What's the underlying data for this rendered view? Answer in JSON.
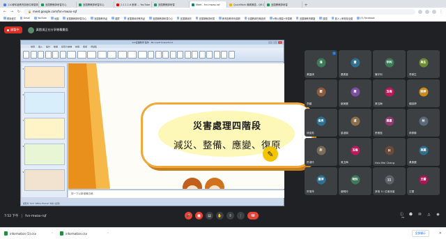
{
  "browser": {
    "tabs": [
      {
        "label": "110學年度教育部數位學習精",
        "color": "#4285f4"
      },
      {
        "label": "宜蘭縣教師研習中心",
        "color": "#0f9d58"
      },
      {
        "label": "宜蘭縣教師研習中心",
        "color": "#0f9d58"
      },
      {
        "label": "2.2.1.1.6 數學 ... YouTube",
        "color": "#ff0000"
      },
      {
        "label": "宜蘭縣教師研習",
        "color": "#0f9d58"
      },
      {
        "label": "Meet - fvn-mwao-rqf",
        "color": "#00897b",
        "active": true
      },
      {
        "label": "QuickMark 條碼掃描 - QR Co",
        "color": "#f4b400"
      },
      {
        "label": "宜蘭縣教師研習",
        "color": "#0f9d58"
      }
    ],
    "url": "meet.google.com/fvn-mwao-rqf",
    "bookmarks": [
      "應用程式",
      "Gmail",
      "YouTube",
      "地圖",
      "宜蘭縣教師研習中心",
      "宜蘭縣教育處",
      "翻譯",
      "宜蘭縣政府教育處",
      "宜蘭縣教師研習中心",
      "宜蘭縣政府",
      "宜蘭縣教師研習",
      "教育部教學資源網",
      "全國教師在職進修",
      "e等公務園+學習網",
      "宜蘭縣教育網路",
      "國語",
      "登入 | 教育部全國",
      "(3) Facebook"
    ]
  },
  "meet": {
    "recording_label": "錄製中",
    "presenter_label": "黃園鴻正在分享螢幕畫面",
    "time": "7:52 下午",
    "code": "fvn-mwao-rqf",
    "participant_count": "23"
  },
  "ppt": {
    "window_title": "110宜蘭教學 製作 - Microsoft PowerPoint",
    "menus": [
      "常用",
      "插入",
      "設計",
      "動畫",
      "投影片放映",
      "校閱",
      "檢視",
      "增益集"
    ],
    "slide_numbers": [
      "5",
      "6",
      "7",
      "8",
      "9"
    ],
    "notes_placeholder": "按一下以新增備忘稿",
    "status": "投影片 7/13   \"Office Theme\"   中文 (台灣)",
    "slide": {
      "title": "災害處理四階段",
      "subtitle": "減災、整備、應變、復原"
    }
  },
  "participants": [
    {
      "name": "黃園鴻",
      "initial": "鴻",
      "color": "#3d7a59",
      "mic": true
    },
    {
      "name": "蕭慶豪",
      "initial": "蕭",
      "color": "#2f6f8f"
    },
    {
      "name": "陳宇利",
      "initial": "宇利",
      "color": "#3d7a59"
    },
    {
      "name": "李美生",
      "initial": "美生",
      "color": "#6c8a2f"
    },
    {
      "name": "李穎",
      "initial": "穎",
      "color": "#8c5a3c"
    },
    {
      "name": "鄭美麗",
      "initial": "鄭",
      "color": "#7a4fa0"
    },
    {
      "name": "張玉梅",
      "initial": "玉梅",
      "color": "#c2185b"
    },
    {
      "name": "鍾詩婷",
      "initial": "詩婷",
      "color": "#c98a1a"
    },
    {
      "name": "林俊男",
      "initial": "俊男",
      "color": "#2f6f8f"
    },
    {
      "name": "梁淑娟",
      "initial": "淑",
      "color": "#8d6e4a"
    },
    {
      "name": "許雅惠",
      "initial": "雅惠",
      "color": "#8e3a6f"
    },
    {
      "name": "林佩琳",
      "initial": "林",
      "color": "#5a6a7a"
    },
    {
      "name": "許淑玲",
      "initial": "許",
      "color": "#7a6a5a"
    },
    {
      "name": "吳玉梅",
      "initial": "玉梅",
      "color": "#c2185b"
    },
    {
      "name": "Hsiu Mei Chang",
      "initial": "H",
      "color": "#6a4a3a"
    },
    {
      "name": "黃美麗",
      "initial": "美麗",
      "color": "#2f6f8f"
    },
    {
      "name": "許惠萍",
      "initial": "惠萍",
      "color": "#2f6f8f"
    },
    {
      "name": "趙明玲",
      "initial": "明玲",
      "color": "#3d7a59"
    },
    {
      "name": "其他 11 位使用者",
      "initial": "11",
      "color": "#5f6368"
    },
    {
      "name": "王雲",
      "initial": "王雲",
      "color": "#ad1457"
    }
  ],
  "downloads": [
    {
      "name": "information (1).csv"
    },
    {
      "name": "information.csv"
    }
  ],
  "downloads_showall": "全部顯示"
}
